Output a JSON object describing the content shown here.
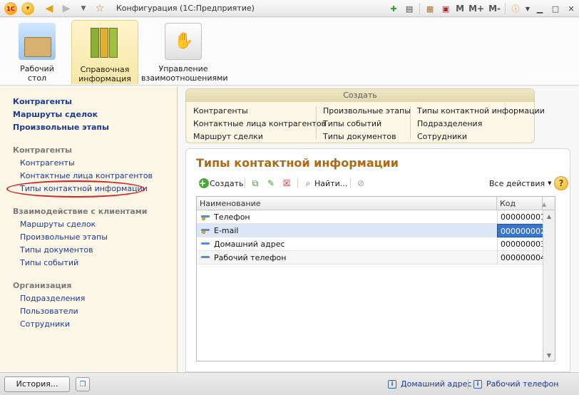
{
  "window": {
    "title": "Конфигурация  (1С:Предприятие)"
  },
  "titlebar": {
    "m_label": "M",
    "mplus_label": "M+",
    "mminus_label": "M-"
  },
  "sections": [
    {
      "label": "Рабочий\nстол"
    },
    {
      "label": "Справочная\nинформация"
    },
    {
      "label": "Управление\nвзаимоотношениями"
    }
  ],
  "left_panel": {
    "top_links": [
      "Контрагенты",
      "Маршруты сделок",
      "Произвольные этапы"
    ],
    "groups": [
      {
        "header": "Контрагенты",
        "items": [
          "Контрагенты",
          "Контактные лица контрагентов",
          "Типы контактной информации"
        ]
      },
      {
        "header": "Взаимодействие с клиентами",
        "items": [
          "Маршруты сделок",
          "Произвольные этапы",
          "Типы документов",
          "Типы событий"
        ]
      },
      {
        "header": "Организация",
        "items": [
          "Подразделения",
          "Пользователи",
          "Сотрудники"
        ]
      }
    ]
  },
  "create_panel": {
    "title": "Создать",
    "columns": [
      [
        "Контрагенты",
        "Контактные лица контрагентов",
        "Маршрут сделки"
      ],
      [
        "Произвольные этапы",
        "Типы событий",
        "Типы документов"
      ],
      [
        "Типы контактной информации",
        "Подразделения",
        "Сотрудники"
      ]
    ]
  },
  "form": {
    "title": "Типы контактной информации",
    "toolbar": {
      "create_label": "Создать",
      "find_label": "Найти...",
      "all_actions_label": "Все действия",
      "help_label": "?"
    },
    "table": {
      "columns": [
        "Наименование",
        "Код"
      ],
      "rows": [
        {
          "name": "Телефон",
          "code": "000000001"
        },
        {
          "name": "E-mail",
          "code": "000000002"
        },
        {
          "name": "Домашний адрес",
          "code": "000000003"
        },
        {
          "name": "Рабочий телефон",
          "code": "000000004"
        }
      ],
      "selected_row": 1
    }
  },
  "statusbar": {
    "history_label": "История...",
    "links": [
      "Домашний адрес",
      "Рабочий телефон"
    ]
  },
  "colors": {
    "accent_title": "#b06a10",
    "link": "#1e3a8a",
    "selection": "#3b76c6",
    "annotation_circle": "#d62020"
  }
}
